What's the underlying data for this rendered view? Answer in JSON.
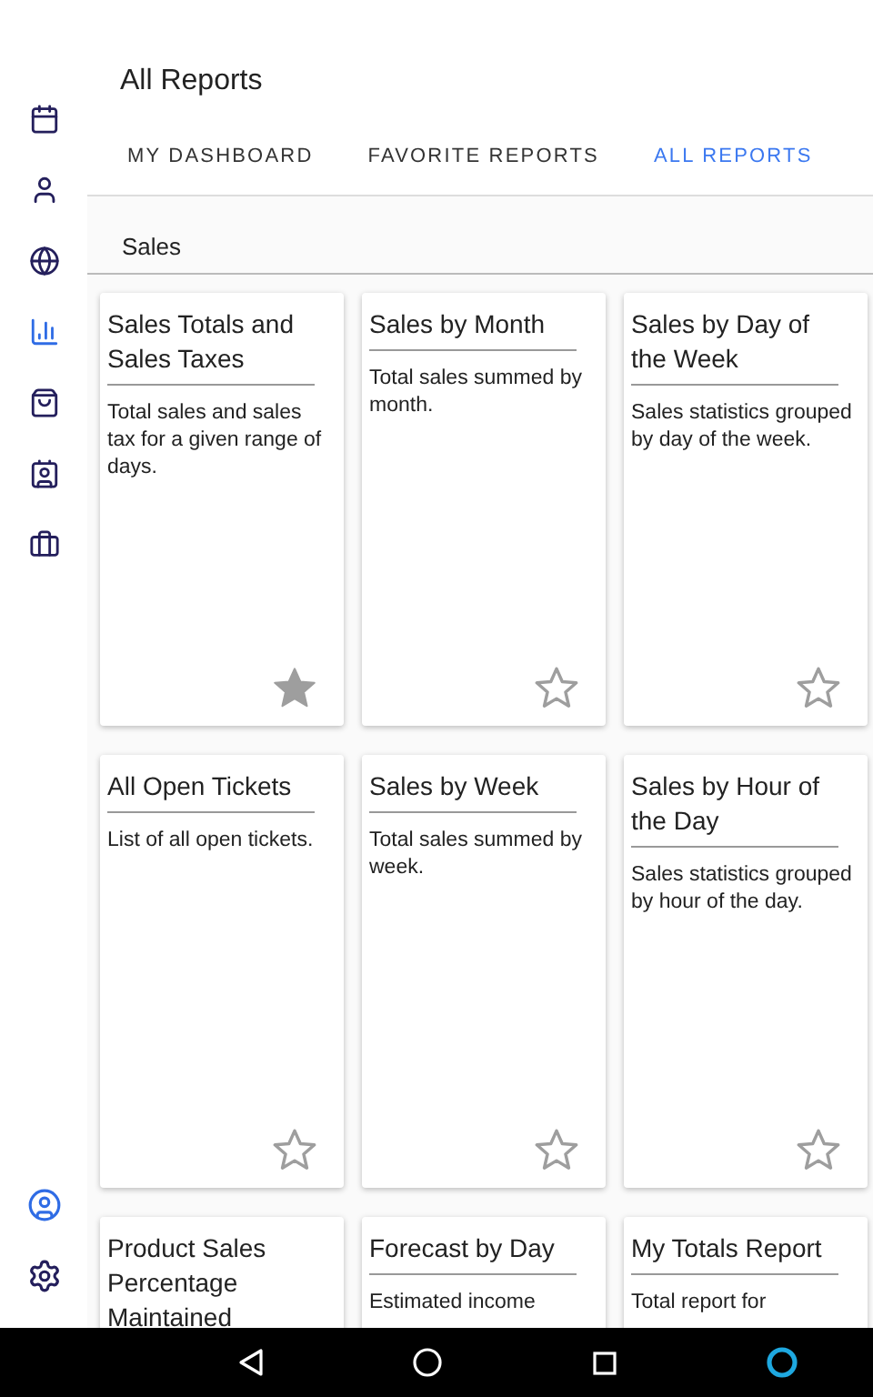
{
  "sidebar": {
    "items": [
      {
        "selected": false
      },
      {
        "selected": false
      },
      {
        "selected": false
      },
      {
        "selected": true
      },
      {
        "selected": false
      },
      {
        "selected": false
      },
      {
        "selected": false
      }
    ]
  },
  "header": {
    "title": "All Reports"
  },
  "tabs": [
    {
      "label": "MY DASHBOARD",
      "selected": false
    },
    {
      "label": "FAVORITE REPORTS",
      "selected": false
    },
    {
      "label": "ALL REPORTS",
      "selected": true
    }
  ],
  "section": {
    "title": "Sales"
  },
  "reports": [
    {
      "title": "Sales Totals and Sales Taxes",
      "description": "Total sales and sales tax for a given range of days.",
      "favorite": true
    },
    {
      "title": "Sales by Month",
      "description": "Total sales summed by month.",
      "favorite": false
    },
    {
      "title": "Sales by Day of the Week",
      "description": "Sales statistics grouped by day of the week.",
      "favorite": false
    },
    {
      "title": "All Open Tickets",
      "description": "List of all open tickets.",
      "favorite": false
    },
    {
      "title": "Sales by Week",
      "description": "Total sales summed by week.",
      "favorite": false
    },
    {
      "title": "Sales by Hour of the Day",
      "description": "Sales statistics grouped by hour of the day.",
      "favorite": false
    },
    {
      "title": "Product Sales Percentage Maintained"
    },
    {
      "title": "Forecast by Day",
      "description": "Estimated income"
    },
    {
      "title": "My Totals Report",
      "description": "Total report for"
    }
  ]
}
